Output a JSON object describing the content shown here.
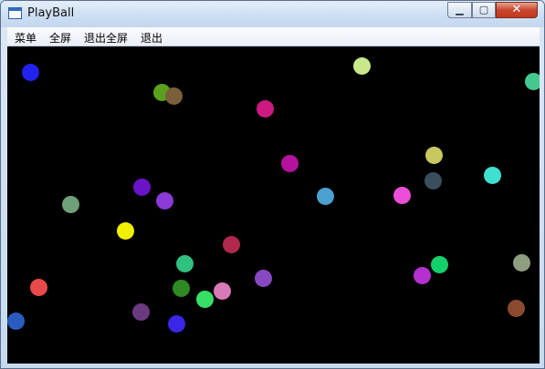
{
  "window": {
    "title": "PlayBall",
    "controls": {
      "minimize_icon": "minimize-icon",
      "maximize_icon": "maximize-icon",
      "close_icon": "close-icon"
    }
  },
  "menubar": {
    "items": [
      "菜单",
      "全屏",
      "退出全屏",
      "退出"
    ]
  },
  "balls": [
    {
      "color": "#2222ee"
    },
    {
      "color": "#5aa01e"
    },
    {
      "color": "#7a5f3a"
    },
    {
      "color": "#cc1a80"
    },
    {
      "color": "#c8e88a"
    },
    {
      "color": "#44c890"
    },
    {
      "color": "#b5129e"
    },
    {
      "color": "#c8c860"
    },
    {
      "color": "#3a4e5c"
    },
    {
      "color": "#40e0d0"
    },
    {
      "color": "#6a14c8"
    },
    {
      "color": "#6fa07a"
    },
    {
      "color": "#8a3ad6"
    },
    {
      "color": "#4aa0d0"
    },
    {
      "color": "#ea4ed8"
    },
    {
      "color": "#f0f000"
    },
    {
      "color": "#b0284c"
    },
    {
      "color": "#30c080"
    },
    {
      "color": "#8848c0"
    },
    {
      "color": "#b430d0"
    },
    {
      "color": "#14d06a"
    },
    {
      "color": "#909e80"
    },
    {
      "color": "#e84a4a"
    },
    {
      "color": "#2e8a22"
    },
    {
      "color": "#d87ab8"
    },
    {
      "color": "#36e066"
    },
    {
      "color": "#6a3a80"
    },
    {
      "color": "#3a26e8"
    },
    {
      "color": "#2a5cc0"
    },
    {
      "color": "#8a4a30"
    }
  ]
}
